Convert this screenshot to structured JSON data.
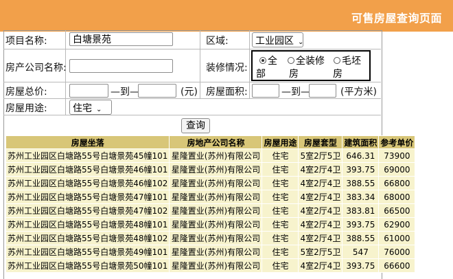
{
  "header": {
    "title": "可售房屋查询页面"
  },
  "form": {
    "project_name_label": "项目名称:",
    "project_name_value": "白塘景苑",
    "district_label": "区域:",
    "district_value": "工业园区",
    "developer_label": "房产公司名称:",
    "developer_value": "",
    "decoration_label": "装修情况:",
    "decoration_options": [
      {
        "label": "全部",
        "selected": true
      },
      {
        "label": "全装修房",
        "selected": false
      },
      {
        "label": "毛坯房",
        "selected": false
      }
    ],
    "price_label": "房屋总价:",
    "to_label": "—到—",
    "price_unit": "(元)",
    "area_label": "房屋面积:",
    "area_unit": "(平方米)",
    "usage_label": "房屋用途:",
    "usage_value": "住宅",
    "search_button": "查询"
  },
  "table": {
    "headers": [
      "房屋坐落",
      "房地产公司名称",
      "房屋用途",
      "房屋套型",
      "建筑面积",
      "参考单价"
    ],
    "rows": [
      [
        "苏州工业园区白塘路55号白塘景苑45幢101",
        "星隆置业(苏州)有限公司",
        "住宅",
        "5室2厅5卫",
        "646.31",
        "73900"
      ],
      [
        "苏州工业园区白塘路55号白塘景苑46幢101",
        "星隆置业(苏州)有限公司",
        "住宅",
        "4室2厅4卫",
        "393.75",
        "69000"
      ],
      [
        "苏州工业园区白塘路55号白塘景苑46幢102",
        "星隆置业(苏州)有限公司",
        "住宅",
        "4室2厅4卫",
        "388.55",
        "66800"
      ],
      [
        "苏州工业园区白塘路55号白塘景苑47幢101",
        "星隆置业(苏州)有限公司",
        "住宅",
        "4室2厅4卫",
        "383.34",
        "68000"
      ],
      [
        "苏州工业园区白塘路55号白塘景苑47幢102",
        "星隆置业(苏州)有限公司",
        "住宅",
        "4室2厅4卫",
        "383.81",
        "66500"
      ],
      [
        "苏州工业园区白塘路55号白塘景苑48幢101",
        "星隆置业(苏州)有限公司",
        "住宅",
        "4室2厅4卫",
        "393.75",
        "62900"
      ],
      [
        "苏州工业园区白塘路55号白塘景苑48幢102",
        "星隆置业(苏州)有限公司",
        "住宅",
        "4室2厅4卫",
        "388.55",
        "61000"
      ],
      [
        "苏州工业园区白塘路55号白塘景苑49幢101",
        "星隆置业(苏州)有限公司",
        "住宅",
        "5室2厅5卫",
        "547",
        "76000"
      ],
      [
        "苏州工业园区白塘路55号白塘景苑50幢101",
        "星隆置业(苏州)有限公司",
        "住宅",
        "4室2厅4卫",
        "393.75",
        "66600"
      ]
    ]
  }
}
